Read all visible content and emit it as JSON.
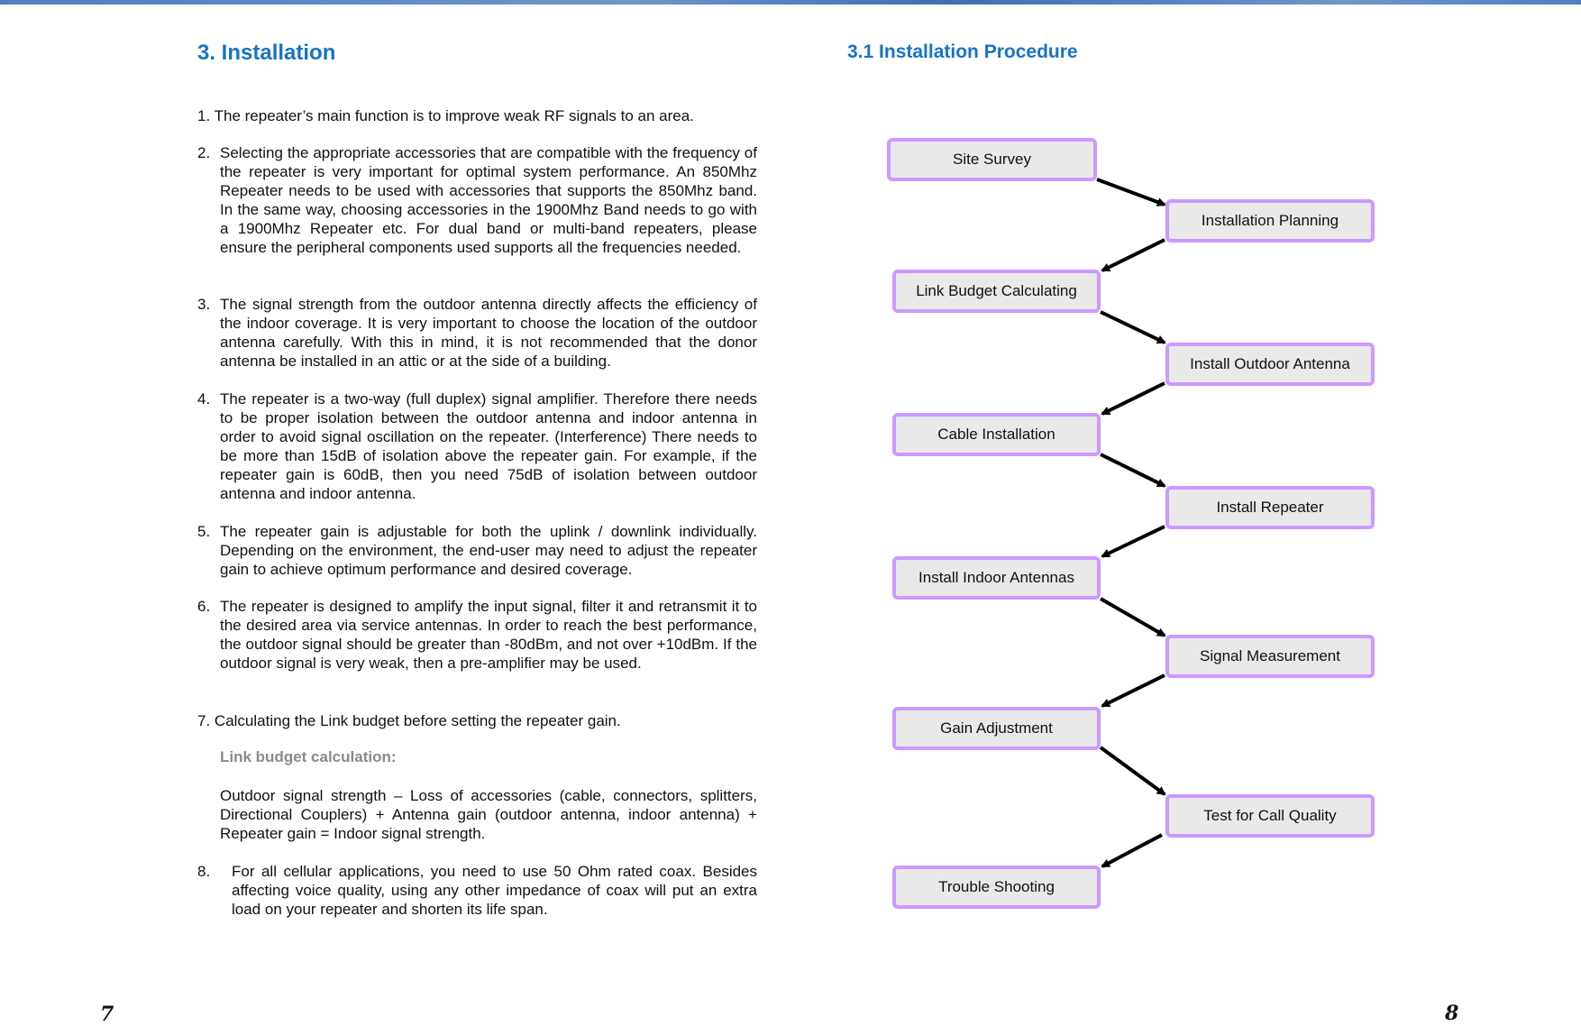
{
  "left_page": {
    "title": "3. Installation",
    "items": [
      {
        "num": "1.",
        "text": "The repeater’s main function is to improve weak RF signals to an area."
      },
      {
        "num": "2.",
        "text": "Selecting the appropriate accessories that are compatible with the frequency of the repeater is very important for optimal system performance. An 850Mhz Repeater needs to be used with accessories that supports the 850Mhz band. In the same way, choosing accessories in the 1900Mhz Band needs to go with a 1900Mhz Repeater etc. For dual band or multi-band repeaters, please ensure the peripheral components used supports all the frequencies needed."
      },
      {
        "num": "3.",
        "text": "The signal strength from the outdoor antenna directly affects the efficiency of the indoor coverage. It is very important to choose the location of the outdoor antenna carefully. With this in mind, it is not recommended that the donor antenna be installed in an attic or at the side of a building."
      },
      {
        "num": "4.",
        "text": "The repeater is a two-way (full duplex) signal amplifier. Therefore there needs to be proper isolation between the outdoor antenna and indoor antenna in order to avoid signal oscillation on the repeater. (Interference) There needs to be more than 15dB of isolation above the repeater gain. For example, if the repeater gain is 60dB, then you need 75dB of isolation between outdoor antenna and indoor antenna."
      },
      {
        "num": "5.",
        "text": "The repeater gain is adjustable for both the uplink / downlink individually. Depending on the environment, the end-user may need to adjust the repeater gain to achieve optimum performance and desired coverage."
      },
      {
        "num": "6.",
        "text": "The repeater is designed to amplify the input signal, filter it and retransmit it to the desired area via service antennas. In order to reach the best performance, the outdoor signal should be greater than -80dBm, and not over +10dBm. If the outdoor signal is very weak, then a pre-amplifier may be used."
      },
      {
        "num": "7.",
        "text": "Calculating the Link budget before setting the repeater gain."
      }
    ],
    "link_budget_label": "Link budget calculation:",
    "link_budget_formula": "Outdoor signal strength – Loss of accessories (cable, connectors, splitters, Directional Couplers) + Antenna gain (outdoor antenna, indoor antenna) + Repeater gain = Indoor signal strength.",
    "item8": {
      "num": "8.",
      "text": "For all cellular applications, you need to use 50 Ohm rated coax. Besides affecting voice quality, using any other impedance of coax will put an extra load on your repeater and shorten its life span."
    },
    "page_number": "7"
  },
  "right_page": {
    "title": "3.1 Installation Procedure",
    "steps": [
      "Site Survey",
      "Installation Planning",
      "Link Budget Calculating",
      "Install Outdoor Antenna",
      "Cable Installation",
      "Install Repeater",
      "Install Indoor Antennas",
      "Signal Measurement",
      "Gain Adjustment",
      "Test for Call Quality",
      "Trouble Shooting"
    ],
    "page_number": "8"
  },
  "colors": {
    "heading": "#1773c6",
    "box_border": "#cc99ff",
    "box_fill": "#e9e9e9",
    "arrow": "#000000",
    "subheading": "#8a8a8a"
  }
}
